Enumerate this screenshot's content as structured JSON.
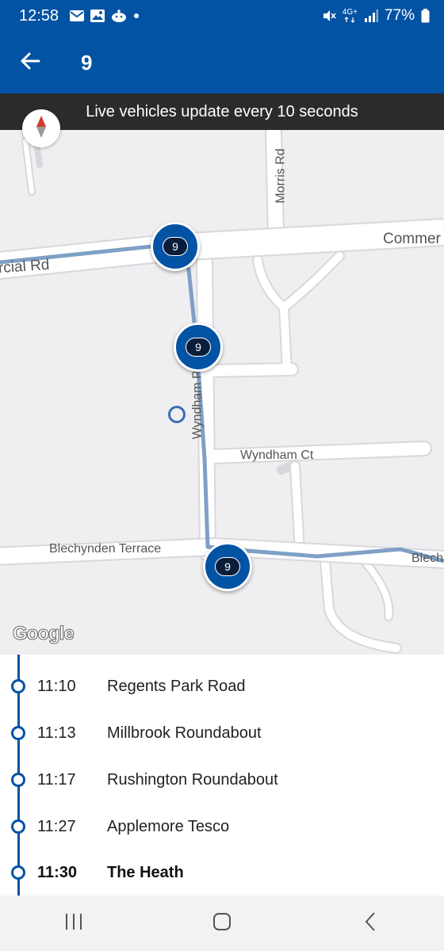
{
  "status_bar": {
    "time": "12:58",
    "left_icons": [
      "mail-icon",
      "image-icon",
      "reddit-icon",
      "dot-icon"
    ],
    "right_icons": [
      "mute-icon",
      "network-4g-icon",
      "signal-icon",
      "battery-icon"
    ],
    "network_label": "4G+",
    "battery": "77%"
  },
  "app_bar": {
    "back_icon": "arrow-left-icon",
    "title": "9"
  },
  "banner": {
    "text": "Live vehicles update every 10 seconds"
  },
  "map": {
    "roads": {
      "commercial_right": "Commer",
      "commercial_left": "rcial Rd",
      "morris": "Morris Rd",
      "wyndham_pl": "Wyndham Pl",
      "wyndham_ct": "Wyndham Ct",
      "blechynden": "Blechynden Terrace",
      "blech_right": "Blech"
    },
    "bus_markers": [
      {
        "route": "9"
      },
      {
        "route": "9"
      },
      {
        "route": "9"
      }
    ],
    "attribution": "Google",
    "route_color": "#7ea0c6",
    "marker_color": "#0353a4"
  },
  "stops": [
    {
      "time": "11:10",
      "name": "Regents Park Road",
      "current": false
    },
    {
      "time": "11:13",
      "name": "Millbrook Roundabout",
      "current": false
    },
    {
      "time": "11:17",
      "name": "Rushington Roundabout",
      "current": false
    },
    {
      "time": "11:27",
      "name": "Applemore Tesco",
      "current": false
    },
    {
      "time": "11:30",
      "name": "The Heath",
      "current": true
    }
  ],
  "nav_bar": {
    "recents_icon": "recents-icon",
    "home_icon": "home-icon",
    "back_icon": "back-chevron-icon"
  },
  "colors": {
    "primary": "#0353a4",
    "banner_bg": "#2b2b2b",
    "map_bg": "#efeff1"
  }
}
